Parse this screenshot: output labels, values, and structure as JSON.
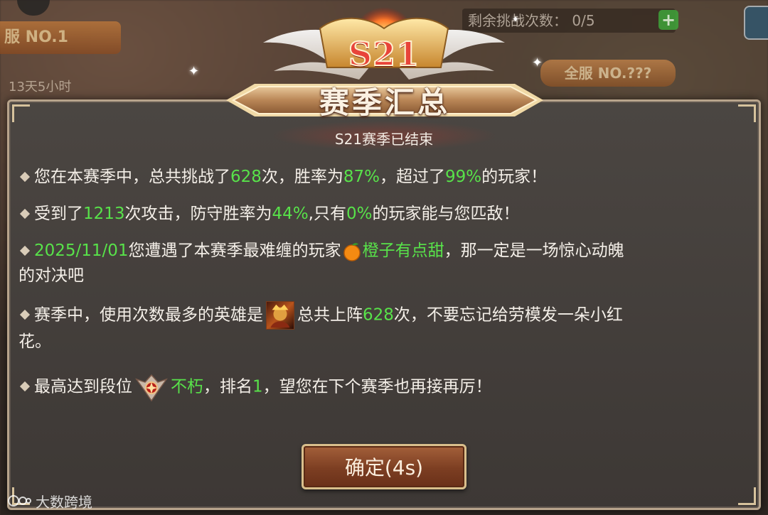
{
  "background": {
    "rank_badge": "服 NO.1",
    "time_left": "13天5小时",
    "remaining_challenges_label": "剩余挑战次数：",
    "remaining_challenges_value": "0/5",
    "plus_label": "+",
    "rank_button": "全服 NO.???"
  },
  "header": {
    "season_badge": "S21",
    "title": "赛季汇总",
    "subtitle": "S21赛季已结束"
  },
  "summary": {
    "line1": {
      "p1": "您在本赛季中，总共挑战了",
      "challenges": "628",
      "p2": "次，胜率为",
      "win_rate": "87%",
      "p3": "，超过了",
      "percentile": "99%",
      "p4": "的玩家！"
    },
    "line2": {
      "p1": "受到了",
      "attacks": "1213",
      "p2": "次攻击，防守胜率为",
      "defense_rate": "44%",
      "p3": ",只有",
      "match_pct": "0%",
      "p4": "的玩家能与您匹敌！"
    },
    "line3": {
      "date": "2025/11/01",
      "p1": "您遭遇了本赛季最难缠的玩家",
      "rival_icon": "orange-icon",
      "rival_name": "橙子有点甜",
      "p2": "，那一定是一场惊心动魄",
      "p3": "的对决吧"
    },
    "line4": {
      "p1": "赛季中，使用次数最多的英雄是",
      "hero_icon": "hero-portrait-icon",
      "p2": "总共上阵",
      "uses": "628",
      "p3": "次，不要忘记给劳模发一朵小红",
      "p4": "花。"
    },
    "line5": {
      "p1": "最高达到段位",
      "rank_icon": "rank-emblem-icon",
      "rank_name": "不朽",
      "p2": "，排名",
      "rank_num": "1",
      "p3": "，望您在下个赛季也再接再厉！"
    }
  },
  "confirm_button": "确定(4s)",
  "watermark": "大数跨境",
  "colors": {
    "highlight": "#58e24a",
    "season_red": "#e8443a",
    "panel_border": "#b8a48c",
    "button_brown": "#7c3e22"
  }
}
